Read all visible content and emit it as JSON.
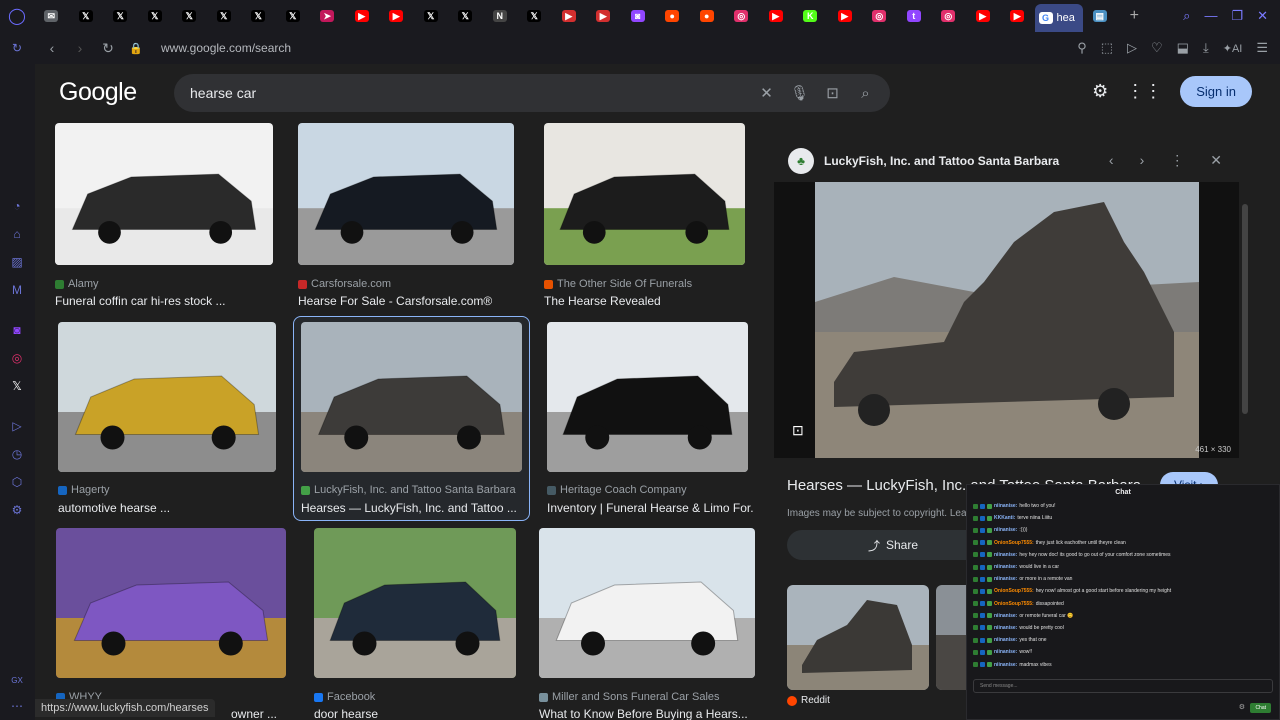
{
  "browser": {
    "active_tab_label": "hea",
    "url": "www.google.com/search",
    "ai_label": "AI",
    "status_url": "https://www.luckyfish.com/hearses",
    "tab_favicons": [
      {
        "name": "gmail-tab",
        "glyph": "✉",
        "color": "#5f6368"
      },
      {
        "name": "x-tab",
        "glyph": "𝕏",
        "color": "#000000"
      },
      {
        "name": "x-tab",
        "glyph": "𝕏",
        "color": "#000000"
      },
      {
        "name": "x-tab",
        "glyph": "𝕏",
        "color": "#000000"
      },
      {
        "name": "x-tab",
        "glyph": "𝕏",
        "color": "#000000"
      },
      {
        "name": "x-tab",
        "glyph": "𝕏",
        "color": "#000000"
      },
      {
        "name": "x-tab",
        "glyph": "𝕏",
        "color": "#000000"
      },
      {
        "name": "x-tab",
        "glyph": "𝕏",
        "color": "#000000"
      },
      {
        "name": "bird-tab",
        "glyph": "➤",
        "color": "#c2185b"
      },
      {
        "name": "youtube-tab",
        "glyph": "▶",
        "color": "#ff0000"
      },
      {
        "name": "youtube-tab",
        "glyph": "▶",
        "color": "#ff0000"
      },
      {
        "name": "x-tab",
        "glyph": "𝕏",
        "color": "#000000"
      },
      {
        "name": "x-tab",
        "glyph": "𝕏",
        "color": "#000000"
      },
      {
        "name": "news-tab",
        "glyph": "N",
        "color": "#444444"
      },
      {
        "name": "x-tab",
        "glyph": "𝕏",
        "color": "#000000"
      },
      {
        "name": "play-tab",
        "glyph": "▶",
        "color": "#d32f2f"
      },
      {
        "name": "play-tab",
        "glyph": "▶",
        "color": "#d32f2f"
      },
      {
        "name": "twitch-tab",
        "glyph": "◙",
        "color": "#9146ff"
      },
      {
        "name": "reddit-tab",
        "glyph": "●",
        "color": "#ff4500"
      },
      {
        "name": "reddit-tab",
        "glyph": "●",
        "color": "#ff4500"
      },
      {
        "name": "instagram-tab",
        "glyph": "◎",
        "color": "#e1306c"
      },
      {
        "name": "youtube-tab",
        "glyph": "▶",
        "color": "#ff0000"
      },
      {
        "name": "kick-tab",
        "glyph": "K",
        "color": "#53fc18"
      },
      {
        "name": "youtube-tab",
        "glyph": "▶",
        "color": "#ff0000"
      },
      {
        "name": "instagram-tab",
        "glyph": "◎",
        "color": "#e1306c"
      },
      {
        "name": "tumblr-tab",
        "glyph": "t",
        "color": "#9146ff"
      },
      {
        "name": "instagram-tab",
        "glyph": "◎",
        "color": "#e1306c"
      },
      {
        "name": "youtube-tab",
        "glyph": "▶",
        "color": "#ff0000"
      },
      {
        "name": "youtube-tab",
        "glyph": "▶",
        "color": "#ff0000"
      }
    ]
  },
  "search": {
    "logo": "Google",
    "query": "hearse car",
    "signin_label": "Sign in"
  },
  "results": [
    {
      "source": "Alamy",
      "title": "Funeral coffin car hi-res stock ...",
      "favcolor": "#2e7d32",
      "sky": "#f2f2f2",
      "ground": "#e9e9e9",
      "car": "#2a2a2a"
    },
    {
      "source": "Carsforsale.com",
      "title": "Hearse For Sale - Carsforsale.com®",
      "favcolor": "#c62828",
      "sky": "#c9d7e3",
      "ground": "#9a9a9a",
      "car": "#151a22"
    },
    {
      "source": "The Other Side Of Funerals",
      "title": "The Hearse Revealed",
      "favcolor": "#e65100",
      "sky": "#e8e6e1",
      "ground": "#7aa050",
      "car": "#1c1c1c"
    },
    {
      "source": "Hagerty",
      "title": "automotive hearse ...",
      "favcolor": "#1565c0",
      "sky": "#cfd8dc",
      "ground": "#8d8d8d",
      "car": "#c9a227"
    },
    {
      "source": "LuckyFish, Inc. and Tattoo Santa Barbara",
      "title": "Hearses — LuckyFish, Inc. and Tattoo ...",
      "favcolor": "#43a047",
      "sky": "#a9b3bb",
      "ground": "#8b857c",
      "car": "#3d3b39"
    },
    {
      "source": "Heritage Coach Company",
      "title": "Inventory | Funeral Hearse & Limo For...",
      "favcolor": "#455a64",
      "sky": "#e4e8ec",
      "ground": "#9e9e9e",
      "car": "#111111"
    },
    {
      "source": "WHYY",
      "title": "owner ...",
      "favcolor": "#1565c0",
      "sky": "#6a4f9c",
      "ground": "#b48a3c",
      "car": "#7e57c2"
    },
    {
      "source": "Facebook",
      "title": "door hearse",
      "favcolor": "#1877f2",
      "sky": "#6f9a58",
      "ground": "#a9a49a",
      "car": "#1f2b3a"
    },
    {
      "source": "Miller and Sons Funeral Car Sales",
      "title": "What to Know Before Buying a Hears...",
      "favcolor": "#78909c",
      "sky": "#d9e3ea",
      "ground": "#b0b0b0",
      "car": "#f2f2f2"
    }
  ],
  "panel": {
    "source": "LuckyFish, Inc. and Tattoo Santa Barbara",
    "dimensions": "461 × 330",
    "title": "Hearses — LuckyFish, Inc. and Tattoo Santa Barbara",
    "visit_label": "Visit",
    "copyright": "Images may be subject to copyright. Lea",
    "share_label": "Share",
    "related_source": "Reddit"
  },
  "chat": {
    "title": "Chat",
    "placeholder": "Send message...",
    "send_label": "Chat",
    "messages": [
      {
        "user": "niinanise:",
        "text": "hello two of you!",
        "color": "#8ab4f8"
      },
      {
        "user": "KKKanti:",
        "text": "terve niina Liiitu",
        "color": "#8ab4f8"
      },
      {
        "user": "niinanise:",
        "text": ":))))",
        "color": "#8ab4f8"
      },
      {
        "user": "OnionSoup7555:",
        "text": "they just lick eachother until theyre clean",
        "color": "#ff8c00"
      },
      {
        "user": "niinanise:",
        "text": "hey hey now doc! its good to go out of your comfort zone sometimes",
        "color": "#8ab4f8"
      },
      {
        "user": "niinanise:",
        "text": "would live in a car",
        "color": "#8ab4f8"
      },
      {
        "user": "niinanise:",
        "text": "or more in a remote van",
        "color": "#8ab4f8"
      },
      {
        "user": "OnionSoup7555:",
        "text": "hey now! almost got a good start before slandering my height",
        "color": "#ff8c00"
      },
      {
        "user": "OnionSoup7555:",
        "text": "dissapointed",
        "color": "#ff8c00"
      },
      {
        "user": "niinanise:",
        "text": "or remote funeral car 😊",
        "color": "#8ab4f8"
      },
      {
        "user": "niinanise:",
        "text": "would be pretty cool",
        "color": "#8ab4f8"
      },
      {
        "user": "niinanise:",
        "text": "yes that one",
        "color": "#8ab4f8"
      },
      {
        "user": "niinanise:",
        "text": "wow!!",
        "color": "#8ab4f8"
      },
      {
        "user": "niinanise:",
        "text": "madmax vibes",
        "color": "#8ab4f8"
      }
    ]
  }
}
